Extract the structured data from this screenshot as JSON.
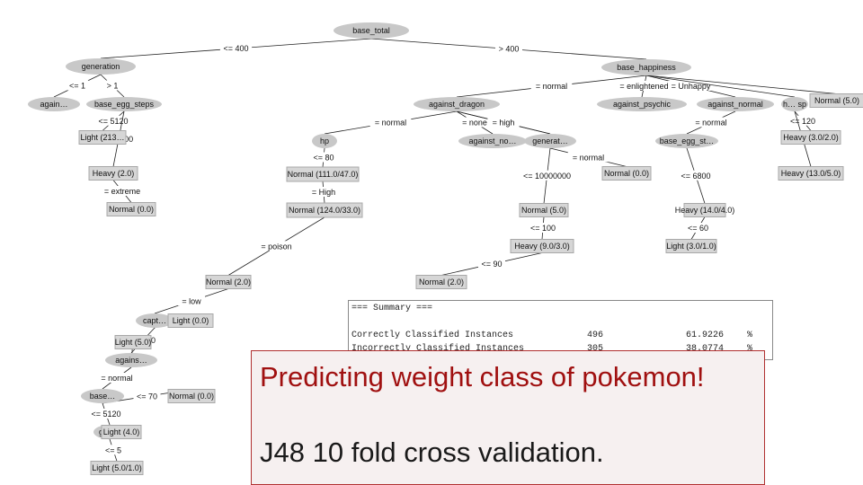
{
  "tree": {
    "nodes": [
      {
        "id": "root",
        "label": "base_total",
        "kind": "split"
      },
      {
        "id": "gen",
        "label": "generation",
        "kind": "split"
      },
      {
        "id": "bh",
        "label": "base_happiness",
        "kind": "split"
      },
      {
        "id": "ag1",
        "label": "again…",
        "kind": "split"
      },
      {
        "id": "bes1",
        "label": "base_egg_steps",
        "kind": "split"
      },
      {
        "id": "adr",
        "label": "against_dragon",
        "kind": "split"
      },
      {
        "id": "aps",
        "label": "against_psychic",
        "kind": "split"
      },
      {
        "id": "anm",
        "label": "against_normal",
        "kind": "split"
      },
      {
        "id": "hsp",
        "label": "h… sp",
        "kind": "split"
      },
      {
        "id": "hp1",
        "label": "hp",
        "kind": "split"
      },
      {
        "id": "ano",
        "label": "against_no…",
        "kind": "split"
      },
      {
        "id": "genr",
        "label": "generat…",
        "kind": "split"
      },
      {
        "id": "bes2",
        "label": "base_egg_st…",
        "kind": "split"
      },
      {
        "id": "cap",
        "label": "capt…",
        "kind": "split"
      },
      {
        "id": "agn",
        "label": "agains…",
        "kind": "split"
      },
      {
        "id": "bse",
        "label": "base…",
        "kind": "split"
      },
      {
        "id": "gn",
        "label": "gen…",
        "kind": "split"
      },
      {
        "id": "l_n50",
        "label": "Normal (5.0)",
        "kind": "leaf"
      },
      {
        "id": "l_h3",
        "label": "Heavy (3.0/2.0)",
        "kind": "leaf"
      },
      {
        "id": "l_h13",
        "label": "Heavy (13.0/5.0)",
        "kind": "leaf"
      },
      {
        "id": "l_n111",
        "label": "Normal (111.0/47.0)",
        "kind": "leaf"
      },
      {
        "id": "l_n124",
        "label": "Normal (124.0/33.0)",
        "kind": "leaf"
      },
      {
        "id": "l_l213",
        "label": "Light (213…",
        "kind": "leaf"
      },
      {
        "id": "l_h2",
        "label": "Heavy (2.0)",
        "kind": "leaf"
      },
      {
        "id": "l_n0",
        "label": "Normal (0.0)",
        "kind": "leaf"
      },
      {
        "id": "l_n0b",
        "label": "Normal (0.0)",
        "kind": "leaf"
      },
      {
        "id": "l_n5",
        "label": "Normal (5.0)",
        "kind": "leaf"
      },
      {
        "id": "l_h9",
        "label": "Heavy (9.0/3.0)",
        "kind": "leaf"
      },
      {
        "id": "l_h14",
        "label": "Heavy (14.0/4.0)",
        "kind": "leaf"
      },
      {
        "id": "l_l3",
        "label": "Light (3.0/1.0)",
        "kind": "leaf"
      },
      {
        "id": "l_n2",
        "label": "Normal (2.0)",
        "kind": "leaf"
      },
      {
        "id": "l_n2b",
        "label": "Normal (2.0)",
        "kind": "leaf"
      },
      {
        "id": "l_l0",
        "label": "Light (0.0)",
        "kind": "leaf"
      },
      {
        "id": "l_l5",
        "label": "Light (5.0)",
        "kind": "leaf"
      },
      {
        "id": "l_n0c",
        "label": "Normal (0.0)",
        "kind": "leaf"
      },
      {
        "id": "l_l4",
        "label": "Light (4.0)",
        "kind": "leaf"
      },
      {
        "id": "l_l51",
        "label": "Light (5.0/1.0)",
        "kind": "leaf"
      }
    ],
    "edges": [
      {
        "from": "root",
        "to": "gen",
        "label": "<= 400"
      },
      {
        "from": "root",
        "to": "bh",
        "label": "> 400"
      },
      {
        "from": "gen",
        "to": "ag1",
        "label": "<= 1"
      },
      {
        "from": "gen",
        "to": "bes1",
        "label": "> 1"
      },
      {
        "from": "bh",
        "to": "adr",
        "label": "= normal"
      },
      {
        "from": "bh",
        "to": "aps",
        "label": "= enlightened"
      },
      {
        "from": "bh",
        "to": "anm",
        "label": "= Unhappy"
      },
      {
        "from": "bh",
        "to": "hsp",
        "label": ""
      },
      {
        "from": "bh",
        "to": "l_n50",
        "label": ""
      },
      {
        "from": "adr",
        "to": "hp1",
        "label": "= normal"
      },
      {
        "from": "adr",
        "to": "ano",
        "label": "= none"
      },
      {
        "from": "adr",
        "to": "genr",
        "label": "= low"
      },
      {
        "from": "adr",
        "to": "genr",
        "label": "= high"
      },
      {
        "from": "anm",
        "to": "bes2",
        "label": "= normal"
      },
      {
        "from": "hp1",
        "to": "l_n111",
        "label": "<= 80"
      },
      {
        "from": "l_n111",
        "to": "l_n124",
        "label": "= High"
      },
      {
        "from": "hsp",
        "to": "l_h3",
        "label": "<= 120"
      },
      {
        "from": "hsp",
        "to": "l_h13",
        "label": "<= 65"
      },
      {
        "from": "bes2",
        "to": "l_h14",
        "label": "<= 6800"
      },
      {
        "from": "l_h14",
        "to": "l_l3",
        "label": "<= 60"
      },
      {
        "from": "bes1",
        "to": "l_l213",
        "label": "<= 5120"
      },
      {
        "from": "bes1",
        "to": "l_h2",
        "label": "<= 1100"
      },
      {
        "from": "l_h2",
        "to": "l_n0",
        "label": "= extreme"
      },
      {
        "from": "genr",
        "to": "l_n0b",
        "label": "= normal"
      },
      {
        "from": "genr",
        "to": "l_n5",
        "label": "<= 10000000"
      },
      {
        "from": "l_n5",
        "to": "l_h9",
        "label": "<= 100"
      },
      {
        "from": "l_h9",
        "to": "l_n2b",
        "label": "<= 90"
      },
      {
        "from": "l_n124",
        "to": "l_n2",
        "label": "= poison"
      },
      {
        "from": "l_n2",
        "to": "cap",
        "label": "= low"
      },
      {
        "from": "cap",
        "to": "l_l0",
        "label": "= extreme"
      },
      {
        "from": "cap",
        "to": "agn",
        "label": "<= 100"
      },
      {
        "from": "agn",
        "to": "l_l5",
        "label": ""
      },
      {
        "from": "agn",
        "to": "bse",
        "label": "= normal"
      },
      {
        "from": "bse",
        "to": "l_n0c",
        "label": "<= 70"
      },
      {
        "from": "bse",
        "to": "gn",
        "label": "<= 5120"
      },
      {
        "from": "gn",
        "to": "l_l4",
        "label": ""
      },
      {
        "from": "gn",
        "to": "l_l51",
        "label": "<= 5"
      }
    ]
  },
  "summary": {
    "header": "=== Summary ===",
    "rows": [
      {
        "label": "Correctly Classified Instances",
        "count": "496",
        "percent": "61.9226",
        "unit": "%"
      },
      {
        "label": "Incorrectly Classified Instances",
        "count": "305",
        "percent": "38.0774",
        "unit": "%"
      }
    ]
  },
  "caption": {
    "title": "Predicting weight class of pokemon!",
    "subtitle": "J48 10 fold cross validation."
  },
  "colors": {
    "title_red": "#a01010",
    "caption_border": "#b03030",
    "node_fill": "#c8c8c8",
    "leaf_fill": "#d6d6d6"
  }
}
